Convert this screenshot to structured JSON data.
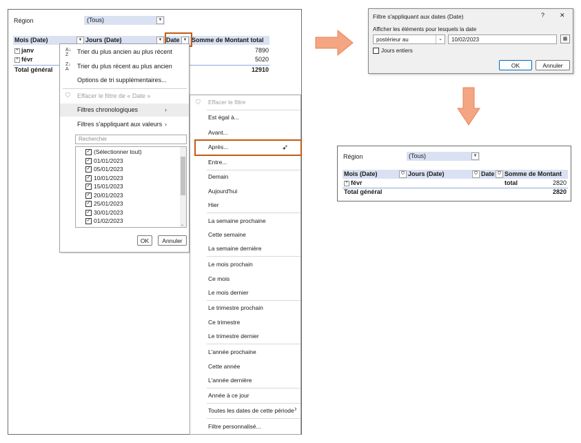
{
  "left_pivot": {
    "region_label": "Région",
    "region_value": "(Tous)",
    "headers": {
      "mois": "Mois (Date)",
      "jours": "Jours (Date)",
      "date": "Date",
      "somme": "Somme de Montant total"
    },
    "rows": [
      {
        "label": "janv",
        "value": "7890"
      },
      {
        "label": "févr",
        "value": "5020"
      }
    ],
    "total_label": "Total général",
    "total_value": "12910"
  },
  "filter_menu": {
    "sort_asc": "Trier du plus ancien au plus récent",
    "sort_desc": "Trier du plus récent au plus ancien",
    "sort_more": "Options de tri supplémentaires...",
    "clear_filter": "Effacer le filtre de « Date »",
    "chrono_filters": "Filtres chronologiques",
    "value_filters": "Filtres s'appliquant aux valeurs",
    "search_placeholder": "Rechercher",
    "items": [
      "(Sélectionner tout)",
      "01/01/2023",
      "05/01/2023",
      "10/01/2023",
      "15/01/2023",
      "20/01/2023",
      "25/01/2023",
      "30/01/2023",
      "01/02/2023"
    ],
    "ok": "OK",
    "cancel": "Annuler"
  },
  "submenu": {
    "clear": "Effacer le filtre",
    "items": [
      "Est égal à...",
      "Avant...",
      "Après...",
      "Entre...",
      "Demain",
      "Aujourd'hui",
      "Hier",
      "La semaine prochaine",
      "Cette semaine",
      "La semaine dernière",
      "Le mois prochain",
      "Ce mois",
      "Le mois dernier",
      "Le trimestre prochain",
      "Ce trimestre",
      "Le trimestre dernier",
      "L'année prochaine",
      "Cette année",
      "L'année dernière",
      "Année à ce jour",
      "Toutes les dates de cette période",
      "Filtre personnalisé..."
    ]
  },
  "dialog": {
    "title": "Filtre s'appliquant aux dates (Date)",
    "help": "?",
    "close": "✕",
    "prompt": "Afficher les éléments pour lesquels la date",
    "operator": "postérieur au",
    "date_value": "10/02/2023",
    "whole_days": "Jours entiers",
    "ok": "OK",
    "cancel": "Annuler"
  },
  "result_pivot": {
    "region_label": "Région",
    "region_value": "(Tous)",
    "headers": {
      "mois": "Mois (Date)",
      "jours": "Jours (Date)",
      "date": "Date",
      "somme": "Somme de Montant total"
    },
    "rows": [
      {
        "label": "févr",
        "value": "2820"
      }
    ],
    "total_label": "Total général",
    "total_value": "2820"
  },
  "colors": {
    "header_bg": "#d9e1f2",
    "highlight": "#c55a11",
    "arrow": "#f4a582"
  }
}
